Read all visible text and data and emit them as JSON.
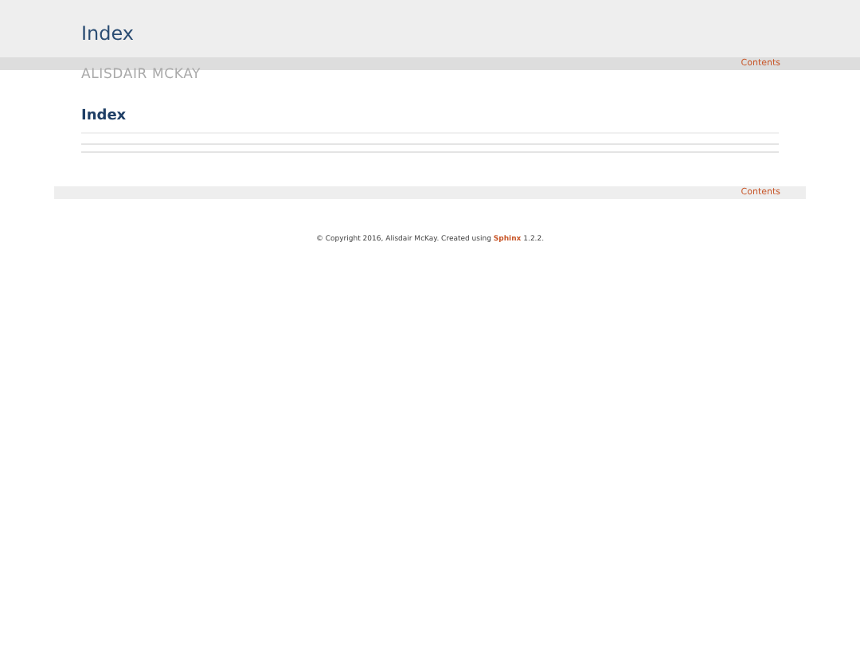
{
  "header": {
    "title": "Index",
    "subtitle": "ALISDAIR MCKAY"
  },
  "top_nav": {
    "link": "Contents"
  },
  "content": {
    "heading": "Index"
  },
  "bottom_nav": {
    "link": "Contents"
  },
  "footer": {
    "text_before": "© Copyright 2016, Alisdair McKay. Created using",
    "link": "Sphinx",
    "text_after": "1.2.2."
  }
}
